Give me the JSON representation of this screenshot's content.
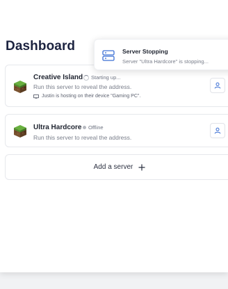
{
  "page": {
    "title": "Dashboard"
  },
  "servers": [
    {
      "name": "Creative Island",
      "status": "Starting up...",
      "status_icon": "spinner-icon",
      "description": "Run this server to reveal the address.",
      "hosting_text": "Justin is hosting on their device \"Gaming PC\".",
      "icon": "grass-block-icon"
    },
    {
      "name": "Ultra Hardcore",
      "status": "Offline",
      "status_icon": "offline-dot-icon",
      "description": "Run this server to reveal the address.",
      "icon": "grass-block-icon"
    }
  ],
  "add_server": {
    "label": "Add a server",
    "icon": "plus-icon"
  },
  "toast": {
    "title": "Server Stopping",
    "message": "Server \"Ultra Hardcore\" is stopping...",
    "icon": "server-icon"
  },
  "colors": {
    "title": "#1c2340",
    "toast_icon": "#3b6fd4",
    "grass_top": "#5fa33a",
    "dirt": "#7a5230"
  }
}
